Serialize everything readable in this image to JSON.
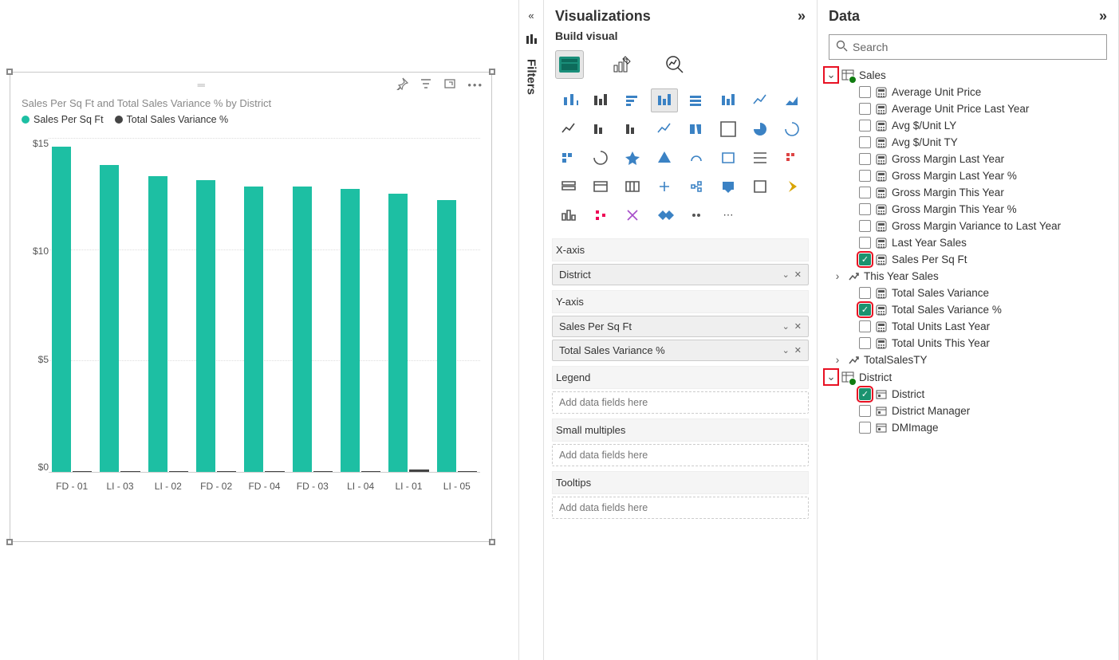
{
  "chart_data": {
    "type": "bar",
    "title": "Sales Per Sq Ft and Total Sales Variance % by District",
    "series": [
      {
        "name": "Sales Per Sq Ft",
        "color": "#1dbfa3",
        "values": [
          14.6,
          13.8,
          13.3,
          13.1,
          12.8,
          12.8,
          12.7,
          12.5,
          12.2
        ]
      },
      {
        "name": "Total Sales Variance %",
        "color": "#444444",
        "values": [
          0.05,
          0.05,
          0.05,
          0.05,
          0.05,
          0.05,
          0.05,
          0.1,
          0.05
        ]
      }
    ],
    "categories": [
      "FD - 01",
      "LI - 03",
      "LI - 02",
      "FD - 02",
      "FD - 04",
      "FD - 03",
      "LI - 04",
      "LI - 01",
      "LI - 05"
    ],
    "ylabel": "",
    "ylim": [
      0,
      15
    ],
    "yticks": [
      "$15",
      "$10",
      "$5",
      "$0"
    ]
  },
  "collapse": {
    "filters_label": "Filters"
  },
  "viz_panel": {
    "title": "Visualizations",
    "subtitle": "Build visual",
    "wells": {
      "xaxis": {
        "label": "X-axis",
        "pill": "District"
      },
      "yaxis": {
        "label": "Y-axis",
        "pill1": "Sales Per Sq Ft",
        "pill2": "Total Sales Variance %"
      },
      "legend": {
        "label": "Legend",
        "placeholder": "Add data fields here"
      },
      "small": {
        "label": "Small multiples",
        "placeholder": "Add data fields here"
      },
      "tooltips": {
        "label": "Tooltips",
        "placeholder": "Add data fields here"
      }
    }
  },
  "data_panel": {
    "title": "Data",
    "search_placeholder": "Search",
    "tables": {
      "sales": {
        "name": "Sales",
        "fields": [
          {
            "label": "Average Unit Price",
            "checked": false
          },
          {
            "label": "Average Unit Price Last Year",
            "checked": false
          },
          {
            "label": "Avg $/Unit LY",
            "checked": false
          },
          {
            "label": "Avg $/Unit TY",
            "checked": false
          },
          {
            "label": "Gross Margin Last Year",
            "checked": false
          },
          {
            "label": "Gross Margin Last Year %",
            "checked": false
          },
          {
            "label": "Gross Margin This Year",
            "checked": false
          },
          {
            "label": "Gross Margin This Year %",
            "checked": false
          },
          {
            "label": "Gross Margin Variance to Last Year",
            "checked": false
          },
          {
            "label": "Last Year Sales",
            "checked": false
          },
          {
            "label": "Sales Per Sq Ft",
            "checked": true
          },
          {
            "label": "This Year Sales",
            "checked": false,
            "hier": true
          },
          {
            "label": "Total Sales Variance",
            "checked": false
          },
          {
            "label": "Total Sales Variance %",
            "checked": true
          },
          {
            "label": "Total Units Last Year",
            "checked": false
          },
          {
            "label": "Total Units This Year",
            "checked": false
          },
          {
            "label": "TotalSalesTY",
            "checked": false,
            "hier": true
          }
        ]
      },
      "district": {
        "name": "District",
        "fields": [
          {
            "label": "District",
            "checked": true,
            "col": true
          },
          {
            "label": "District Manager",
            "checked": false,
            "col": true
          },
          {
            "label": "DMImage",
            "checked": false,
            "col": true
          }
        ]
      }
    }
  }
}
